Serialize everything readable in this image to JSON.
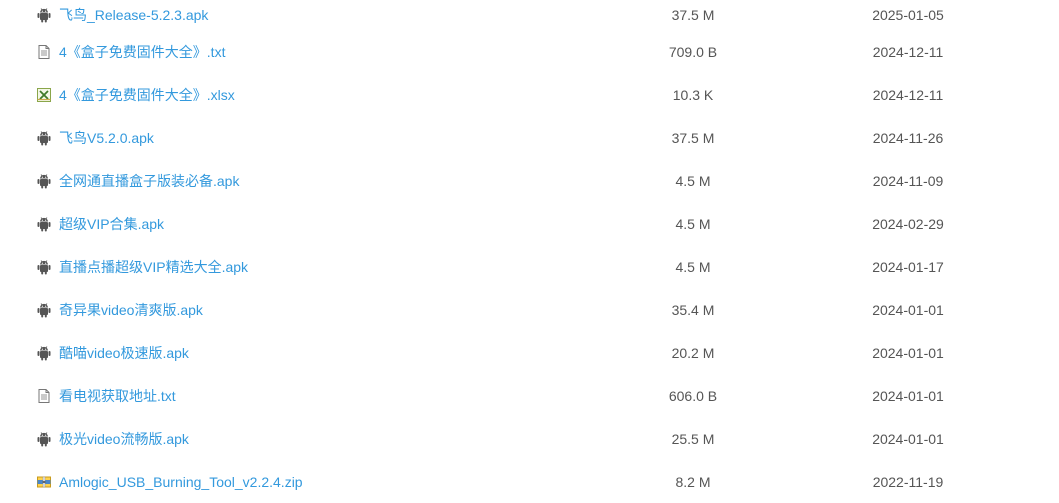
{
  "files": [
    {
      "name": "飞鸟_Release-5.2.3.apk",
      "icon": "android-icon",
      "size": "37.5 M",
      "date": "2025-01-05"
    },
    {
      "name": "4《盒子免费固件大全》.txt",
      "icon": "text-file-icon",
      "size": "709.0 B",
      "date": "2024-12-11"
    },
    {
      "name": "4《盒子免费固件大全》.xlsx",
      "icon": "excel-file-icon",
      "size": "10.3 K",
      "date": "2024-12-11"
    },
    {
      "name": "飞鸟V5.2.0.apk",
      "icon": "android-icon",
      "size": "37.5 M",
      "date": "2024-11-26"
    },
    {
      "name": "全网通直播盒子版装必备.apk",
      "icon": "android-icon",
      "size": "4.5 M",
      "date": "2024-11-09"
    },
    {
      "name": "超级VIP合集.apk",
      "icon": "android-icon",
      "size": "4.5 M",
      "date": "2024-02-29"
    },
    {
      "name": "直播点播超级VIP精选大全.apk",
      "icon": "android-icon",
      "size": "4.5 M",
      "date": "2024-01-17"
    },
    {
      "name": "奇异果video清爽版.apk",
      "icon": "android-icon",
      "size": "35.4 M",
      "date": "2024-01-01"
    },
    {
      "name": "酷喵video极速版.apk",
      "icon": "android-icon",
      "size": "20.2 M",
      "date": "2024-01-01"
    },
    {
      "name": "看电视获取地址.txt",
      "icon": "text-file-icon",
      "size": "606.0 B",
      "date": "2024-01-01"
    },
    {
      "name": "极光video流畅版.apk",
      "icon": "android-icon",
      "size": "25.5 M",
      "date": "2024-01-01"
    },
    {
      "name": "Amlogic_USB_Burning_Tool_v2.2.4.zip",
      "icon": "zip-file-icon",
      "size": "8.2 M",
      "date": "2022-11-19"
    }
  ],
  "colors": {
    "link": "#3399dd",
    "text": "#555555",
    "icon": "#555555"
  }
}
